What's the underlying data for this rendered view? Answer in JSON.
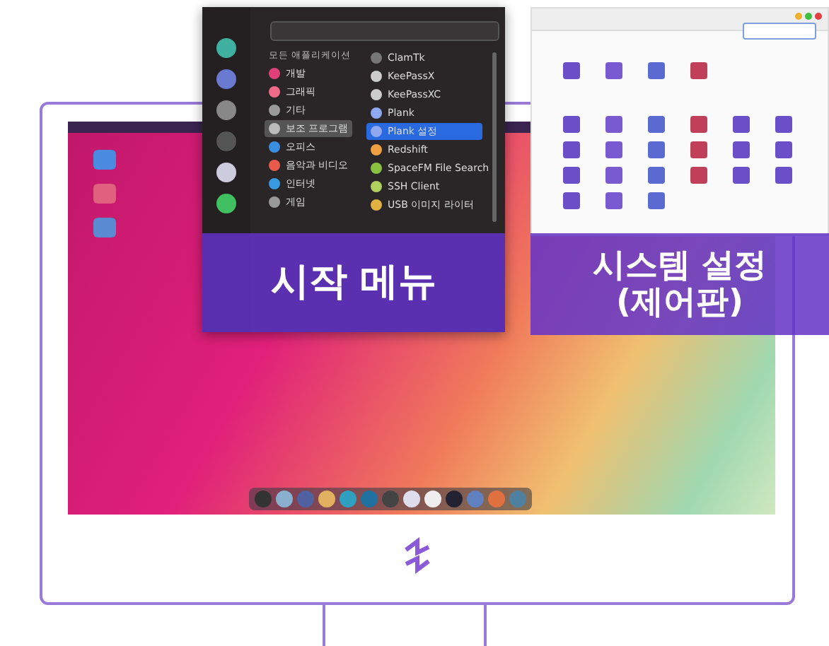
{
  "start_menu": {
    "caption": "시작 메뉴",
    "category_header": "모든 애플리케이션",
    "categories": [
      {
        "label": "개발",
        "color": "#e0407a",
        "selected": false
      },
      {
        "label": "그래픽",
        "color": "#f06a8a",
        "selected": false
      },
      {
        "label": "기타",
        "color": "#9a9a9a",
        "selected": false
      },
      {
        "label": "보조 프로그램",
        "color": "#bbbbbb",
        "selected": true
      },
      {
        "label": "오피스",
        "color": "#3a8ee0",
        "selected": false
      },
      {
        "label": "음악과 비디오",
        "color": "#e85a4a",
        "selected": false
      },
      {
        "label": "인터넷",
        "color": "#3a9ae0",
        "selected": false
      },
      {
        "label": "게임",
        "color": "#999999",
        "selected": false
      }
    ],
    "apps": [
      {
        "label": "ClamTk",
        "color": "#777777",
        "selected": false
      },
      {
        "label": "KeePassX",
        "color": "#cccccc",
        "selected": false
      },
      {
        "label": "KeePassXC",
        "color": "#cccccc",
        "selected": false
      },
      {
        "label": "Plank",
        "color": "#8fa8f0",
        "selected": false
      },
      {
        "label": "Plank 설정",
        "color": "#8fa8f0",
        "selected": true
      },
      {
        "label": "Redshift",
        "color": "#f0a040",
        "selected": false
      },
      {
        "label": "SpaceFM File Search",
        "color": "#8ac040",
        "selected": false
      },
      {
        "label": "SSH Client",
        "color": "#b0d060",
        "selected": false
      },
      {
        "label": "USB 이미지 라이터",
        "color": "#e0b040",
        "selected": false
      }
    ]
  },
  "settings": {
    "caption_line1": "시스템 설정",
    "caption_line2": "(제어판)"
  }
}
